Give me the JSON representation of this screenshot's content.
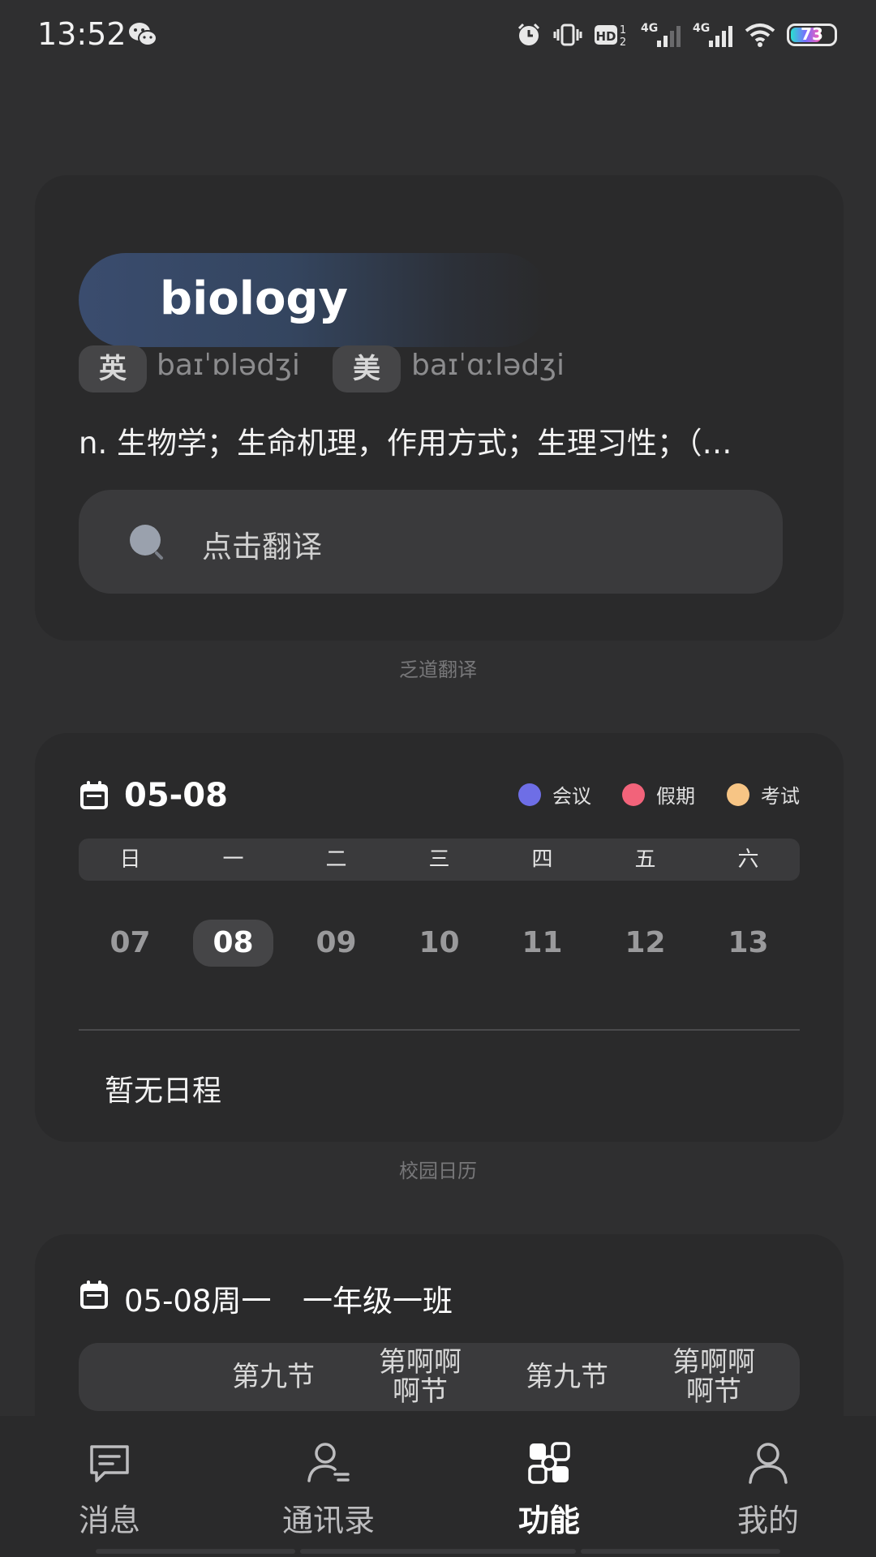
{
  "status_bar": {
    "time": "13:52",
    "battery_level": "73",
    "icons": [
      "wechat-icon",
      "alarm-icon",
      "vibrate-icon",
      "hd-icon",
      "signal-4g-icon",
      "signal-4g-icon",
      "wifi-icon",
      "battery-icon"
    ]
  },
  "translate_card": {
    "word": "biology",
    "uk_badge": "英",
    "uk_phonetic": "baɪˈɒlədʒi",
    "us_badge": "美",
    "us_phonetic": "baɪˈɑːlədʒi",
    "definition": "n. 生物学；生命机理，作用方式；生理习性；（…",
    "search_placeholder": "点击翻译",
    "caption": "乏道翻译"
  },
  "calendar_card": {
    "date": "05-08",
    "legend": [
      {
        "label": "会议",
        "color": "#6e6ee6"
      },
      {
        "label": "假期",
        "color": "#f2637a"
      },
      {
        "label": "考试",
        "color": "#f7c585"
      }
    ],
    "weekdays": [
      "日",
      "一",
      "二",
      "三",
      "四",
      "五",
      "六"
    ],
    "dates": [
      "07",
      "08",
      "09",
      "10",
      "11",
      "12",
      "13"
    ],
    "selected_date": "08",
    "empty_text": "暂无日程",
    "caption": "校园日历"
  },
  "schedule_card": {
    "title": "05-08周一",
    "class_name": "一年级一班",
    "periods": [
      "第九节",
      "第啊啊\n啊节",
      "第九节",
      "第啊啊\n啊节"
    ]
  },
  "bottom_nav": {
    "items": [
      {
        "label": "消息",
        "icon": "message-icon"
      },
      {
        "label": "通讯录",
        "icon": "contacts-icon"
      },
      {
        "label": "功能",
        "icon": "functions-icon"
      },
      {
        "label": "我的",
        "icon": "profile-icon"
      }
    ],
    "active": "功能"
  },
  "colors": {
    "background": "#2f2f30",
    "card": "#2a2a2b",
    "accent_pill": "#3a4c6e"
  }
}
